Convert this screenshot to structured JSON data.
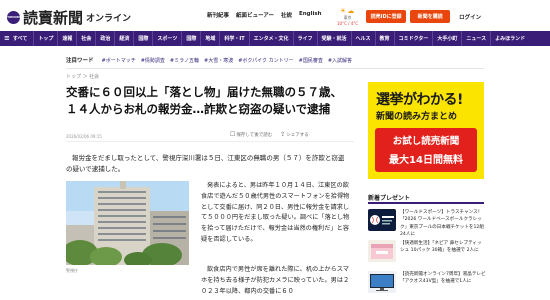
{
  "header": {
    "logo_mark": "YOMIURI",
    "logo_title": "読賣新聞",
    "logo_sub": "オンライン",
    "links": [
      "新刊紀事",
      "紙面ビューアー",
      "社説",
      "English"
    ],
    "weather": {
      "icons": "☀☁",
      "location": "東京",
      "temp": "10°C / 4°C"
    },
    "register_label": "読売IDに登録",
    "subscribe_label": "新聞を購読",
    "login_label": "ログイン"
  },
  "nav": {
    "all_label": "すべて",
    "items": [
      "トップ",
      "速報",
      "社会",
      "政治",
      "経済",
      "国際",
      "スポーツ",
      "国際",
      "地域",
      "科学・IT",
      "エンタメ・文化",
      "ライフ",
      "受験・就活",
      "ヘルス",
      "教育",
      "コミドクター",
      "大手小町",
      "ニュース",
      "よみほランド"
    ]
  },
  "tags": {
    "label": "注目ワード",
    "items": [
      "#ボートマッチ",
      "#情勢調査",
      "#ミラノ五輪",
      "#大雪・寒波",
      "#ボクパイク カントリー",
      "#国民審査",
      "#入試解答"
    ]
  },
  "breadcrumb": "トップ ＞ 社会",
  "article": {
    "headline": "交番に６０回以上「落とし物」届けた無職の５７歳、１４人からお札の報労金…詐欺と窃盗の疑いで逮捕",
    "date": "2026/02/06 09:15",
    "save_label": "保存して後で読む",
    "share_label": "シェアする",
    "lead": "報労金をだまし取ったとして、警視庁深川署は５日、江東区の無職の男（５７）を詐欺と窃盗の疑いで逮捕した。",
    "caption": "警視庁",
    "body1": "発表によると、男は昨年１０月１４日、江東区の飲食店で遊んだ５０歳代男性のスマートフォンを拾得物として交番に届け、同２０日、男性に報労金を請求して５０００円をだまし取った疑い。調べに「落とし物を拾って届けただけで、報労金は当然の権利だ」と容疑を否認している。",
    "body2": "飲食店内で男性が席を離れた際に、机の上からスマホを持ち去る様子が防犯カメラに映っていた。男は２０２３年以降、都内の交番に６０"
  },
  "ad": {
    "line1": "選挙がわかる!",
    "line2": "新聞の読み方まとめ",
    "box_line1": "お試し読売新聞",
    "box_line2": "最大14日間無料"
  },
  "gifts": {
    "heading": "新着プレゼント",
    "items": [
      {
        "text": "【ワールドスポーツ】トラスチャンス！「2026 ワールドベースボールクラシック」東京プールの日本戦チケットを12組24人に"
      },
      {
        "text": "【快適新生活】「ネピア 鼻セレブティッシュ 10パック 30箱」を抽選で 2人に"
      },
      {
        "text": "【読売新聞オンライン7周年】液晶テレビ「アクオス43V型」を抽選で1人に"
      }
    ]
  }
}
